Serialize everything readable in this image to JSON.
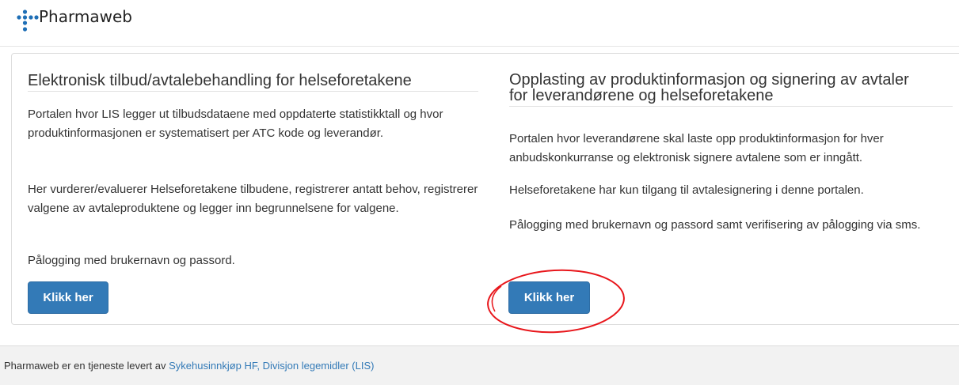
{
  "header": {
    "logo_text": "Pharmaweb",
    "logo_icon": "pharmaweb-dots-logo",
    "colors": {
      "dot": "#1f6fb6"
    }
  },
  "left_column": {
    "title": "Elektronisk tilbud/avtalebehandling for helseforetakene",
    "paragraph_1": "Portalen hvor LIS legger ut tilbudsdataene med oppdaterte statistikktall og hvor produktinformasjonen er systematisert per ATC kode og leverandør.",
    "paragraph_2": "Her vurderer/evaluerer Helseforetakene tilbudene, registrerer antatt behov, registrerer valgene av avtaleproduktene og legger inn begrunnelsene for valgene.",
    "paragraph_3": "Pålogging med brukernavn og passord.",
    "button_label": "Klikk her"
  },
  "right_column": {
    "title_line_1": "Opplasting av produktinformasjon og signering av avtaler",
    "title_line_2": "for leverandørene og helseforetakene",
    "paragraph_1": "Portalen hvor leverandørene skal laste opp produktinformasjon for hver anbudskonkurranse og elektronisk signere avtalene som er inngått.",
    "paragraph_2": "Helseforetakene har kun tilgang til avtalesignering i denne portalen.",
    "paragraph_3": "Pålogging med brukernavn og passord samt verifisering av pålogging via sms.",
    "button_label": "Klikk her"
  },
  "footer": {
    "text": "Pharmaweb er en tjeneste levert av ",
    "link_text": "Sykehusinnkjøp HF, Divisjon legemidler (LIS)"
  },
  "colors": {
    "button": "#337ab7",
    "link": "#337ab7",
    "annotation_circle": "#e8161b"
  }
}
